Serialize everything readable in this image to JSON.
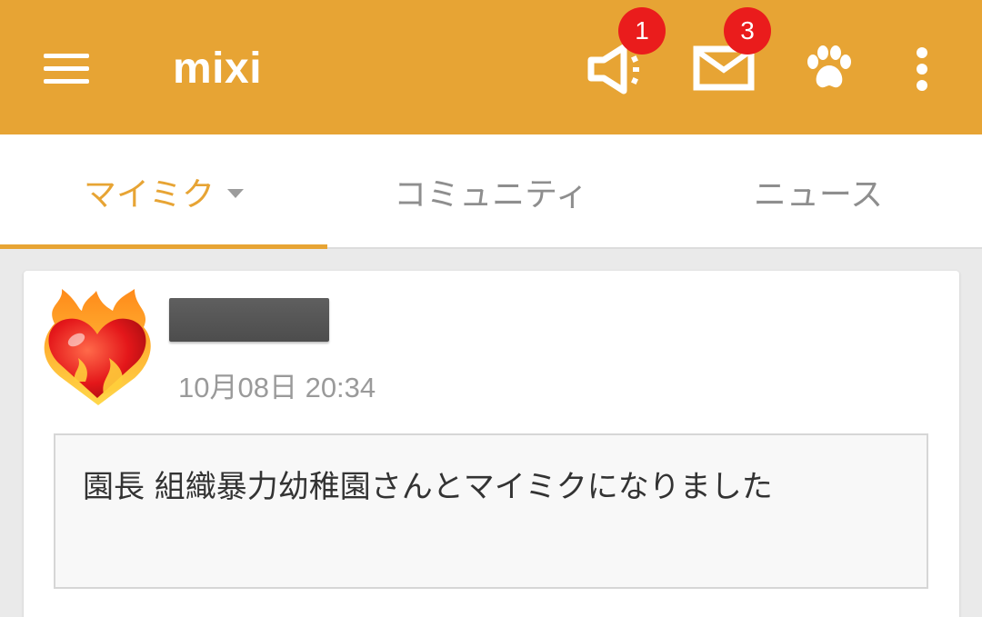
{
  "app_bar": {
    "title": "mixi",
    "notifications_badge": "1",
    "messages_badge": "3",
    "background_color": "#e7a434",
    "icons": [
      "menu-icon",
      "megaphone-icon",
      "mail-icon",
      "paw-icon",
      "more-vert-icon"
    ]
  },
  "tabs": [
    {
      "label": "マイミク",
      "active": true
    },
    {
      "label": "コミュニティ",
      "active": false
    },
    {
      "label": "ニュース",
      "active": false
    }
  ],
  "feed": {
    "items": [
      {
        "avatar": "flaming-heart-emoji",
        "timestamp": "10月08日 20:34",
        "body": "園長 組織暴力幼稚園さんとマイミクになりました"
      }
    ]
  },
  "colors": {
    "accent": "#e7a434",
    "badge": "#ea1c1c"
  }
}
